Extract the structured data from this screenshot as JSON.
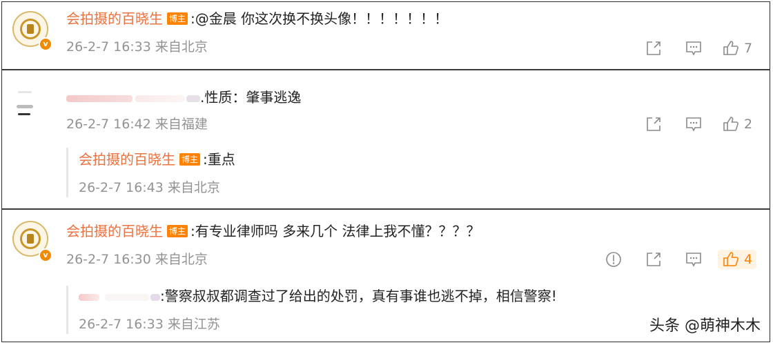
{
  "comments": [
    {
      "author": "会拍摄的百晓生",
      "badge": "博主",
      "text": ":@金晨 你这次换不换头像！！！！！！！",
      "meta": "26-2-7 16:33 来自北京",
      "likes": "7"
    },
    {
      "author": "",
      "text": ".性质：肇事逃逸",
      "meta": "26-2-7 16:42 来自福建",
      "likes": "2",
      "reply": {
        "author": "会拍摄的百晓生",
        "badge": "博主",
        "text": ":重点",
        "meta": "26-2-7 16:43 来自北京"
      }
    },
    {
      "author": "会拍摄的百晓生",
      "badge": "博主",
      "text": ":有专业律师吗 多来几个 法律上我不懂？？？？",
      "meta": "26-2-7 16:30 来自北京",
      "likes": "4",
      "reply": {
        "author": "",
        "text": ":警察叔叔都调查过了给出的处罚，真有事谁也逃不掉，相信警察!",
        "meta": "26-2-7 16:33 来自江苏"
      }
    }
  ],
  "watermark": "头条 @萌神木木",
  "colors": {
    "accent": "#eb7340",
    "badge": "#ff8200",
    "meta": "#939393",
    "liked": "#ff8200"
  }
}
